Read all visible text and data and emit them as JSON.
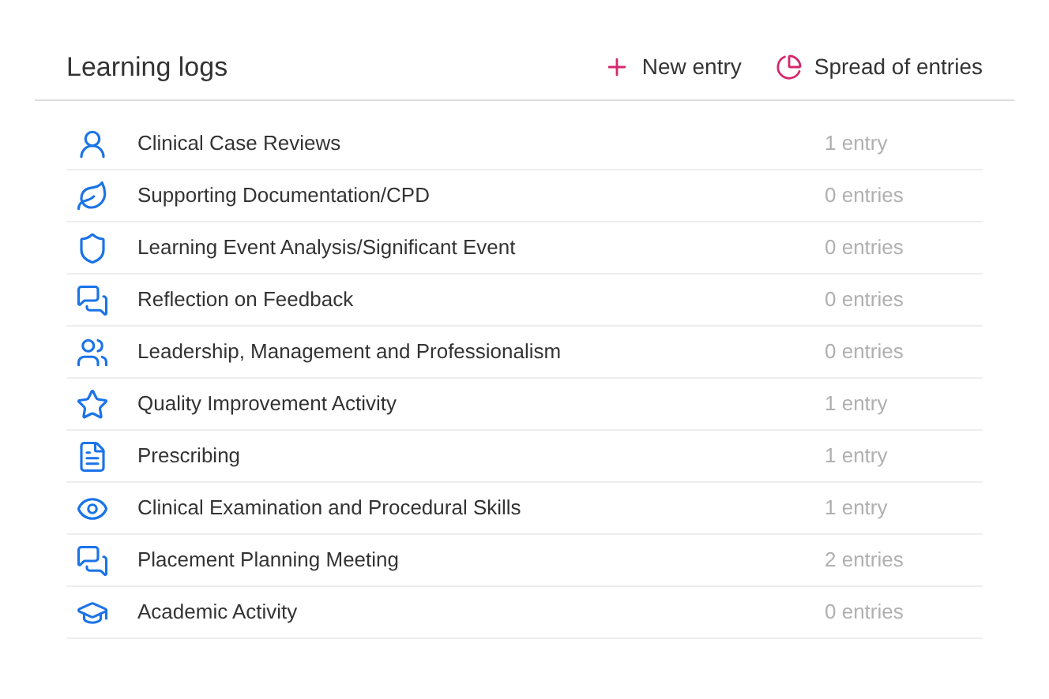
{
  "header": {
    "title": "Learning logs",
    "actions": [
      {
        "label": "New entry"
      },
      {
        "label": "Spread of entries"
      }
    ]
  },
  "logs": [
    {
      "name": "Clinical Case Reviews",
      "count": "1 entry"
    },
    {
      "name": "Supporting Documentation/CPD",
      "count": "0 entries"
    },
    {
      "name": "Learning Event Analysis/Significant Event",
      "count": "0 entries"
    },
    {
      "name": "Reflection on Feedback",
      "count": "0 entries"
    },
    {
      "name": "Leadership, Management and Professionalism",
      "count": "0 entries"
    },
    {
      "name": "Quality Improvement Activity",
      "count": "1 entry"
    },
    {
      "name": "Prescribing",
      "count": "1 entry"
    },
    {
      "name": "Clinical Examination and Procedural Skills",
      "count": "1 entry"
    },
    {
      "name": "Placement Planning Meeting",
      "count": "2 entries"
    },
    {
      "name": "Academic Activity",
      "count": "0 entries"
    }
  ]
}
